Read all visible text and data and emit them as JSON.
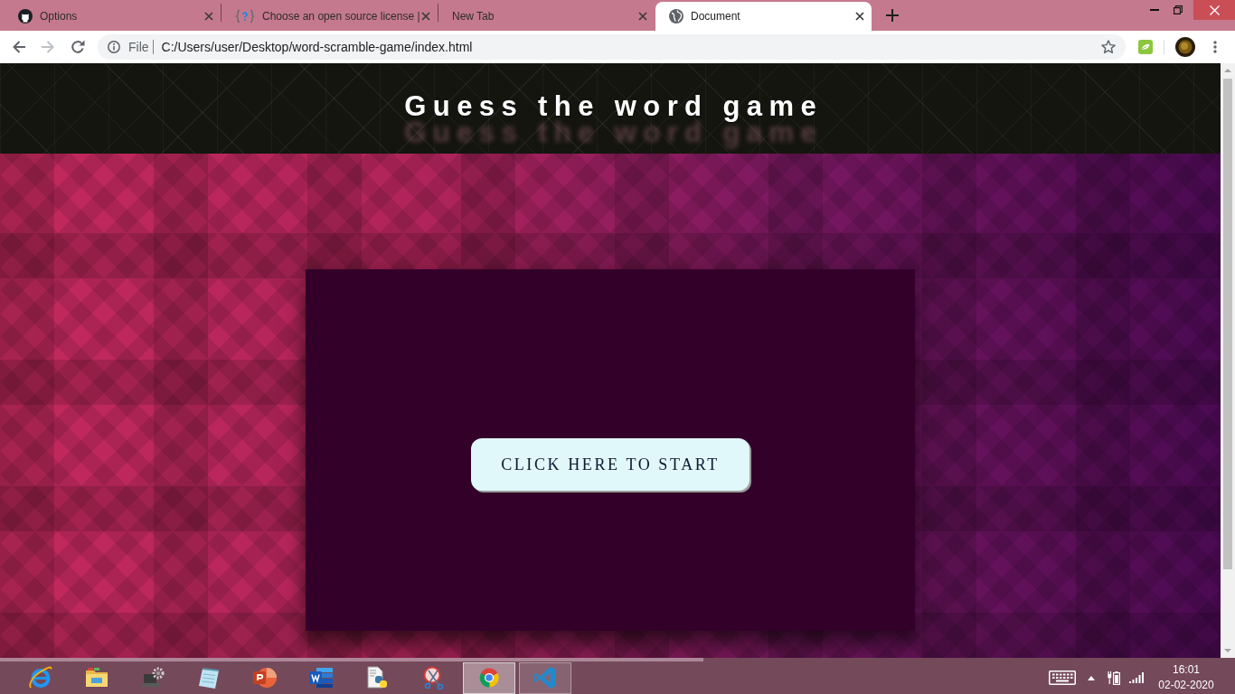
{
  "browser": {
    "tabs": [
      {
        "title": "Options",
        "selected": false
      },
      {
        "title": "Choose an open source license |",
        "selected": false
      },
      {
        "title": "New Tab",
        "selected": false
      },
      {
        "title": "Document",
        "selected": true
      }
    ],
    "navigation": {
      "back_enabled": true,
      "forward_enabled": false
    },
    "address_bar": {
      "scheme": "File",
      "url": "C:/Users/user/Desktop/word-scramble-game/index.html"
    }
  },
  "page": {
    "heading": "Guess the word game",
    "start_button": "CLICK HERE TO START"
  },
  "taskbar": {
    "apps": [
      {
        "running": false,
        "selected": false
      },
      {
        "running": false,
        "selected": false
      },
      {
        "running": false,
        "selected": false
      },
      {
        "running": false,
        "selected": false
      },
      {
        "running": false,
        "selected": false
      },
      {
        "running": false,
        "selected": false
      },
      {
        "running": false,
        "selected": false
      },
      {
        "running": false,
        "selected": false
      },
      {
        "running": true,
        "selected": true
      },
      {
        "running": true,
        "selected": false
      }
    ],
    "clock": {
      "time": "16:01",
      "date": "02-02-2020"
    }
  }
}
